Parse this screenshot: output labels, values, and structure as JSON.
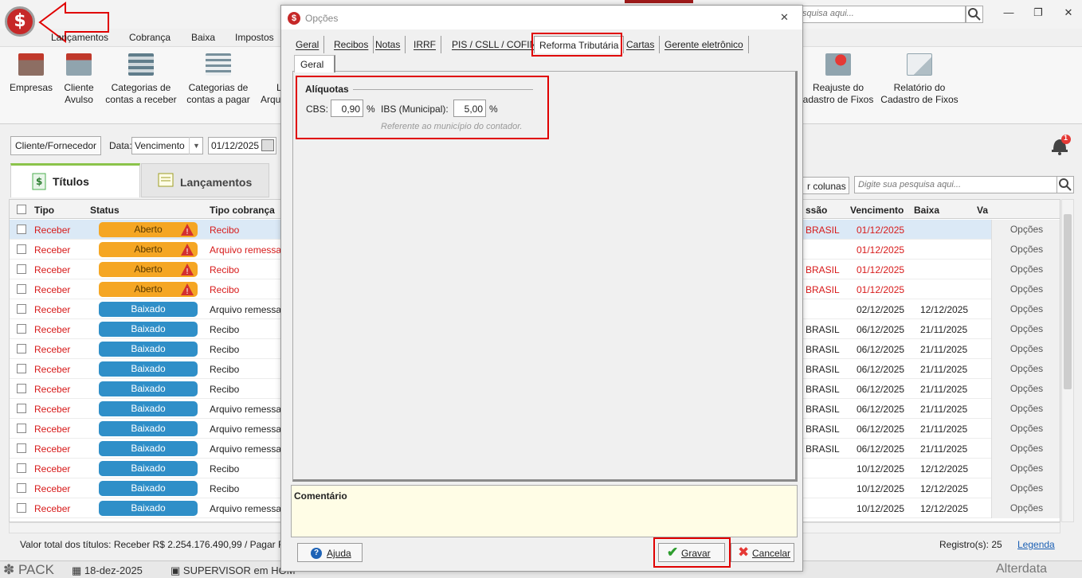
{
  "window": {
    "search_placeholder": "squisa aqui..."
  },
  "menu": [
    "Lançamentos",
    "Cobrança",
    "Baixa",
    "Impostos"
  ],
  "ribbon": {
    "empresas": "Empresas",
    "cliente_avulso_1": "Cliente",
    "cliente_avulso_2": "Avulso",
    "cat_receber_1": "Categorias de",
    "cat_receber_2": "contas a receber",
    "cat_pagar_1": "Categorias de",
    "cat_pagar_2": "contas a pagar",
    "partial_1": "L",
    "partial_2": "Arqu",
    "reajuste_1": "Reajuste do",
    "reajuste_2": "adastro de Fixos",
    "relatorio_1": "Relatório do",
    "relatorio_2": "Cadastro de Fixos"
  },
  "filters": {
    "cliente_btn": "Cliente/Fornecedor",
    "data_label": "Data:",
    "data_select": "Vencimento",
    "date_value": "01/12/2025"
  },
  "tabs": {
    "titulos": "Títulos",
    "lancamentos": "Lançamentos"
  },
  "grid_tools": {
    "colunas_btn": "r colunas",
    "search_placeholder": "Digite sua pesquisa aqui...",
    "notifications_count": "1"
  },
  "columns": {
    "tipo": "Tipo",
    "status": "Status",
    "tipo_cobranca": "Tipo cobrança",
    "emissao": "ssão",
    "vencimento": "Vencimento",
    "baixa": "Baixa",
    "valor": "Va"
  },
  "rows": [
    {
      "tipo": "Receber",
      "status": "Aberto",
      "cobranca": "Recibo",
      "emissao": "BRASIL",
      "venc": "01/12/2025",
      "baixa": "",
      "opc": "Opções"
    },
    {
      "tipo": "Receber",
      "status": "Aberto",
      "cobranca": "Arquivo remessa",
      "emissao": "",
      "venc": "01/12/2025",
      "baixa": "",
      "opc": "Opções"
    },
    {
      "tipo": "Receber",
      "status": "Aberto",
      "cobranca": "Recibo",
      "emissao": "BRASIL",
      "venc": "01/12/2025",
      "baixa": "",
      "opc": "Opções"
    },
    {
      "tipo": "Receber",
      "status": "Aberto",
      "cobranca": "Recibo",
      "emissao": "BRASIL",
      "venc": "01/12/2025",
      "baixa": "",
      "opc": "Opções"
    },
    {
      "tipo": "Receber",
      "status": "Baixado",
      "cobranca": "Arquivo remessa",
      "emissao": "",
      "venc": "02/12/2025",
      "baixa": "12/12/2025",
      "opc": "Opções"
    },
    {
      "tipo": "Receber",
      "status": "Baixado",
      "cobranca": "Recibo",
      "emissao": "BRASIL",
      "venc": "06/12/2025",
      "baixa": "21/11/2025",
      "opc": "Opções"
    },
    {
      "tipo": "Receber",
      "status": "Baixado",
      "cobranca": "Recibo",
      "emissao": "BRASIL",
      "venc": "06/12/2025",
      "baixa": "21/11/2025",
      "opc": "Opções"
    },
    {
      "tipo": "Receber",
      "status": "Baixado",
      "cobranca": "Recibo",
      "emissao": "BRASIL",
      "venc": "06/12/2025",
      "baixa": "21/11/2025",
      "opc": "Opções"
    },
    {
      "tipo": "Receber",
      "status": "Baixado",
      "cobranca": "Recibo",
      "emissao": "BRASIL",
      "venc": "06/12/2025",
      "baixa": "21/11/2025",
      "opc": "Opções"
    },
    {
      "tipo": "Receber",
      "status": "Baixado",
      "cobranca": "Arquivo remessa",
      "emissao": "BRASIL",
      "venc": "06/12/2025",
      "baixa": "21/11/2025",
      "opc": "Opções"
    },
    {
      "tipo": "Receber",
      "status": "Baixado",
      "cobranca": "Arquivo remessa",
      "emissao": "BRASIL",
      "venc": "06/12/2025",
      "baixa": "21/11/2025",
      "opc": "Opções"
    },
    {
      "tipo": "Receber",
      "status": "Baixado",
      "cobranca": "Arquivo remessa",
      "emissao": "BRASIL",
      "venc": "06/12/2025",
      "baixa": "21/11/2025",
      "opc": "Opções"
    },
    {
      "tipo": "Receber",
      "status": "Baixado",
      "cobranca": "Recibo",
      "emissao": "",
      "venc": "10/12/2025",
      "baixa": "12/12/2025",
      "opc": "Opções"
    },
    {
      "tipo": "Receber",
      "status": "Baixado",
      "cobranca": "Recibo",
      "emissao": "",
      "venc": "10/12/2025",
      "baixa": "12/12/2025",
      "opc": "Opções"
    },
    {
      "tipo": "Receber",
      "status": "Baixado",
      "cobranca": "Arquivo remessa",
      "emissao": "",
      "venc": "10/12/2025",
      "baixa": "12/12/2025",
      "opc": "Opções"
    }
  ],
  "footer": {
    "totals": "Valor total dos títulos: Receber R$ 2.254.176.490,99 / Pagar R$ C",
    "registros": "Registro(s): 25",
    "legenda": "Legenda"
  },
  "statusbar": {
    "pack": "PACK",
    "date": "18-dez-2025",
    "user": "SUPERVISOR em HOM",
    "brand": "Alterdata"
  },
  "dialog": {
    "title": "Opções",
    "close": "✕",
    "tabs": [
      "Geral",
      "Recibos",
      "Notas",
      "IRRF",
      "PIS / CSLL / COFINS",
      "Reforma Tributária",
      "Cartas",
      "Gerente eletrônico"
    ],
    "active_tab": "Reforma Tributária",
    "subtab": "Geral",
    "section_title": "Alíquotas",
    "cbs_label": "CBS:",
    "cbs_value": "0,90",
    "cbs_unit": "%",
    "ibs_label": "IBS (Municipal):",
    "ibs_value": "5,00",
    "ibs_unit": "%",
    "note": "Referente ao município do contador.",
    "comment_label": "Comentário",
    "btn_ajuda": "Ajuda",
    "btn_gravar": "Gravar",
    "btn_cancelar": "Cancelar"
  },
  "colors": {
    "accent_red": "#e00000",
    "status_open": "#f5a623",
    "status_paid": "#2f8fc8",
    "receber_red": "#d71a1a"
  }
}
